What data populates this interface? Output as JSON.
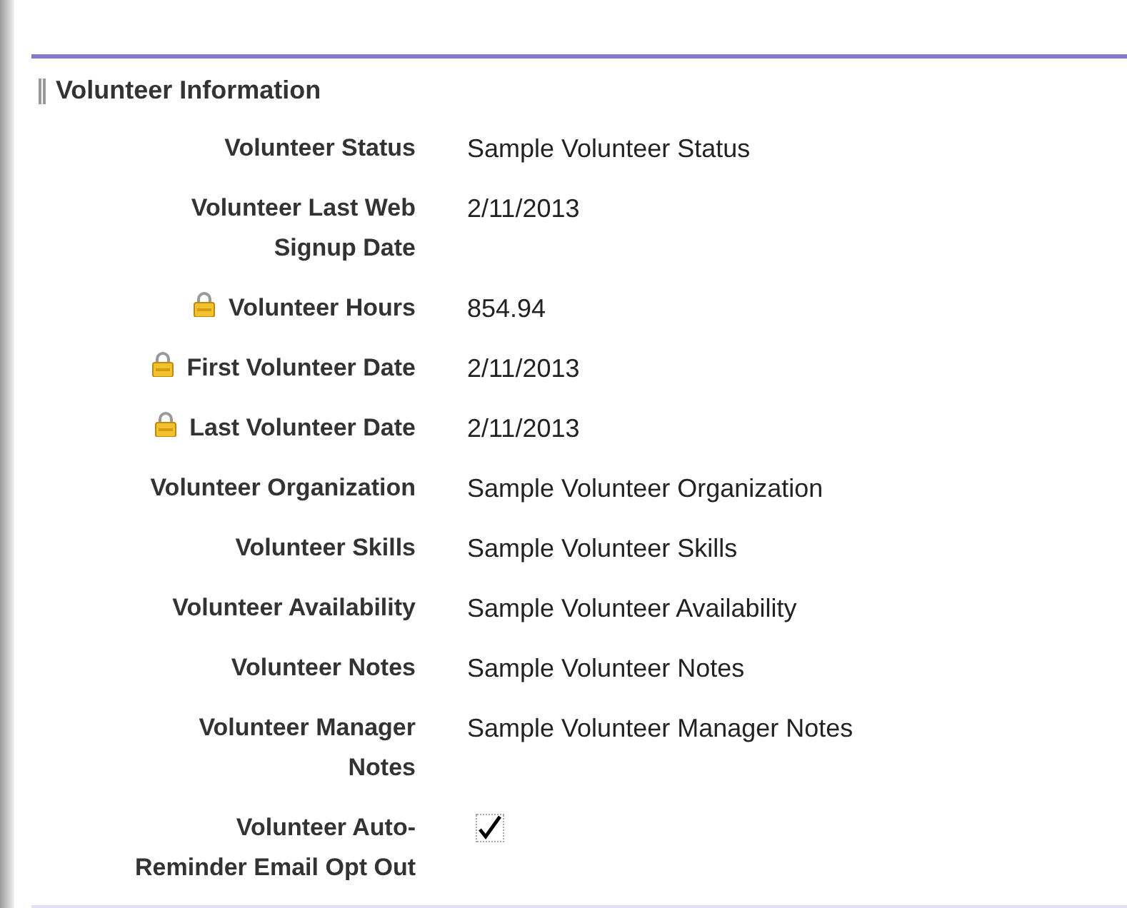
{
  "section": {
    "title": "Volunteer Information"
  },
  "fields": [
    {
      "kind": "text",
      "label_lines": [
        "Volunteer Status"
      ],
      "locked": false,
      "value": "Sample Volunteer Status"
    },
    {
      "kind": "text",
      "label_lines": [
        "Volunteer Last Web",
        "Signup Date"
      ],
      "locked": false,
      "value": "2/11/2013"
    },
    {
      "kind": "text",
      "label_lines": [
        "Volunteer Hours"
      ],
      "locked": true,
      "value": "854.94"
    },
    {
      "kind": "text",
      "label_lines": [
        "First Volunteer Date"
      ],
      "locked": true,
      "value": "2/11/2013"
    },
    {
      "kind": "text",
      "label_lines": [
        "Last Volunteer Date"
      ],
      "locked": true,
      "value": "2/11/2013"
    },
    {
      "kind": "text",
      "label_lines": [
        "Volunteer Organization"
      ],
      "locked": false,
      "value": "Sample Volunteer Organization"
    },
    {
      "kind": "text",
      "label_lines": [
        "Volunteer Skills"
      ],
      "locked": false,
      "value": "Sample Volunteer Skills"
    },
    {
      "kind": "text",
      "label_lines": [
        "Volunteer Availability"
      ],
      "locked": false,
      "value": "Sample Volunteer Availability"
    },
    {
      "kind": "text",
      "label_lines": [
        "Volunteer Notes"
      ],
      "locked": false,
      "value": "Sample Volunteer Notes"
    },
    {
      "kind": "text",
      "label_lines": [
        "Volunteer Manager",
        "Notes"
      ],
      "locked": false,
      "value": "Sample Volunteer Manager Notes"
    },
    {
      "kind": "checkbox",
      "label_lines": [
        "Volunteer Auto-",
        "Reminder Email Opt Out"
      ],
      "locked": false,
      "checked": true
    }
  ]
}
